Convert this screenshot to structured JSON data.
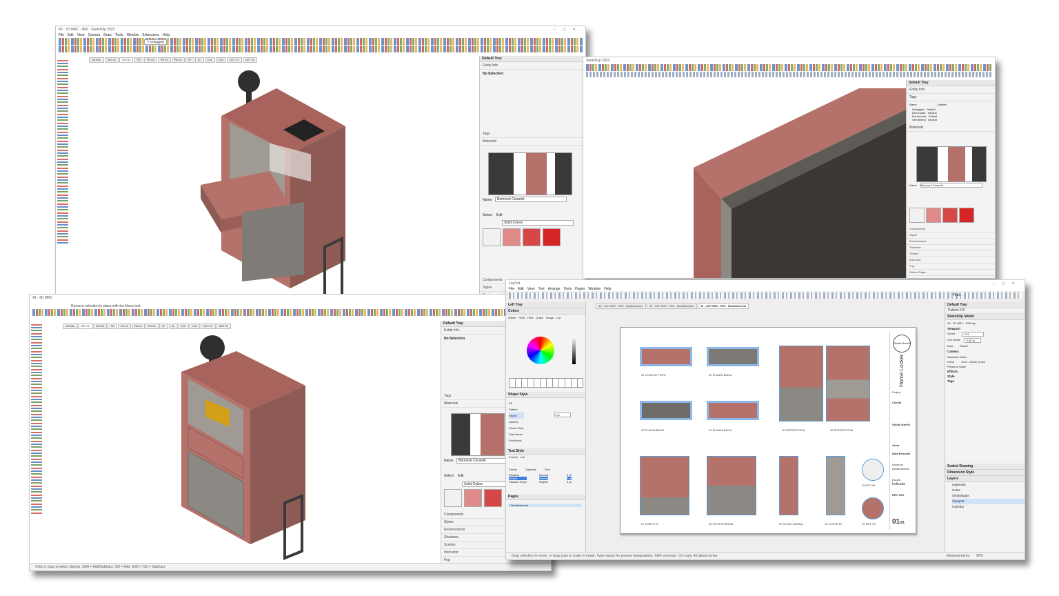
{
  "win1": {
    "title": "49 - 3D MRC - R00 - SketchUp 2023",
    "menus": [
      "File",
      "Edit",
      "View",
      "Camera",
      "Draw",
      "Tools",
      "Window",
      "Extensions",
      "Help"
    ],
    "tag_dropdown": "Untagged",
    "scene_tabs": [
      "GERAL",
      "ISO 01",
      "ISO 02",
      "PB",
      "PB 02",
      "PB 03",
      "PB 04",
      "VF",
      "VL",
      "C01",
      "C02",
      "DET 01",
      "DET 02"
    ],
    "tray_title": "Default Tray",
    "entity_info": "Entity Info",
    "no_selection": "No Selection",
    "tags": "Tags",
    "materials": "Materials",
    "material_name_label": "Name",
    "material_name": "Bermeck Ceramik",
    "select_tab": "Select",
    "edit_tab": "Edit",
    "solid_colors": "Solid Colors",
    "panels": [
      "Components",
      "Styles",
      "Environments",
      "Shadows",
      "Scenes",
      "Instructor",
      "Fog"
    ]
  },
  "win2": {
    "title": "SketchUp 2023",
    "tag_dropdown": "Untagged",
    "tray_title": "Default Tray",
    "entity_info": "Entity Info",
    "tags": "Tags",
    "tag_col_name": "Name",
    "tag_col_dashes": "Dashes",
    "tag_rows": [
      {
        "name": "Untagged",
        "dash": "Default",
        "color": "#333333"
      },
      {
        "name": "Decoração",
        "dash": "Default",
        "color": "#c0392b"
      },
      {
        "name": "Marcenaria",
        "dash": "Default",
        "color": "#2e5fa8"
      },
      {
        "name": "Serralheria",
        "dash": "Default",
        "color": "#d4a017"
      }
    ],
    "materials": "Materials",
    "material_name_label": "Name",
    "material_name": "Bermeck Ceramik",
    "select_tab": "Select",
    "edit_tab": "Edit",
    "solid_colors": "Solid Colors",
    "panels": [
      "Components",
      "Styles",
      "Environments",
      "Shadows",
      "Scenes",
      "Instructor",
      "Fog",
      "Soften Edges"
    ]
  },
  "win3": {
    "title": "49 - 3D MRC",
    "status_hint": "Remove selection to place with the Move tool.",
    "scene_tabs": [
      "GERAL",
      "ISO 01",
      "ISO 02",
      "PB",
      "PB 02",
      "PB 03",
      "PB 04",
      "VF",
      "VL",
      "C01",
      "C02",
      "DET 01",
      "DET 02"
    ],
    "tray_title": "Default Tray",
    "entity_info": "Entity Info",
    "no_selection": "No Selection",
    "tags": "Tags",
    "materials": "Materials",
    "material_name_label": "Name",
    "material_name": "Bermeck Ceramik",
    "select_tab": "Select",
    "edit_tab": "Edit",
    "solid_colors": "Solid Colors",
    "panels": [
      "Components",
      "Styles",
      "Environments",
      "Shadows",
      "Scenes",
      "Instructor",
      "Fog"
    ],
    "status": "Click or drag to select objects. Shift = Add/Subtract. Ctrl = Add. Shift + Ctrl = Subtract."
  },
  "layout": {
    "title": "LayOut",
    "menus": [
      "File",
      "Edit",
      "View",
      "Text",
      "Arrange",
      "Tools",
      "Pages",
      "Window",
      "Help"
    ],
    "doc_tabs": [
      "49 - LAY MRC - R00 - Detalhamento",
      "49 - LAY MRC - R00 - Detalhamento",
      "49 - LAY MRC - R00 - Detalhamento"
    ],
    "find": "Find...",
    "left_tray": "Left Tray",
    "colors": "Colors",
    "color_tabs": [
      "Wheel",
      "RGB",
      "HSB",
      "Grays",
      "Image",
      "List"
    ],
    "shape_style": "Shape Style",
    "shape_rows": [
      "Fill",
      "Pattern",
      "Stroke",
      "Dashes",
      "Stroke Style",
      "Start Arrow",
      "End Arrow"
    ],
    "stroke_size": "1 pt",
    "text_style": "Text Style",
    "text_tabs": [
      "Format",
      "List"
    ],
    "font_family_label": "Family",
    "font_typeface_label": "Typeface",
    "font_size_label": "Size",
    "fonts": [
      "Verdana",
      "Vivaldi",
      "Vladimir Script"
    ],
    "typefaces": [
      "Normal",
      "Normal",
      "Negrito"
    ],
    "sizes": [
      "5 pt",
      "5 pt",
      "5 pt"
    ],
    "pages": "Pages",
    "page_name": "1  Detalhamento",
    "right_tray": "Default Tray",
    "pattern_fill": "Pattern Fill",
    "sketchup_model": "SketchUp Model",
    "model_file": "49 - 3D MRC - R00.skp",
    "viewport": "Viewport",
    "scene_label": "Scene",
    "scene_value": "C01",
    "line_scale": "Line Scale",
    "line_scale_value": "0.50 pt",
    "render_auto": "Auto",
    "render_mode": "Raster",
    "camera": "Camera",
    "standard_views": "Standard Views",
    "ortho": "Ortho",
    "scale": "1mm : 25mm (1:25)",
    "preserve_scale": "Preserve Scale",
    "effects": "Effects",
    "style": "Style",
    "tags": "Tags",
    "reset": "Reset",
    "scaled_drawing": "Scaled Drawing",
    "dimension_style": "Dimension Style",
    "layers": "Layers",
    "layer_list": [
      "Legendas",
      "Cotas",
      "Simbologias",
      "Viewport",
      "Carimbo"
    ],
    "status": "Drag selection to move, or drag grips to scale or rotate. Type values for precise manipulation. Shift constrain. Ctrl copy. Alt about center.",
    "measurements": "Measurements",
    "zoom": "50%",
    "sheet": {
      "views": [
        {
          "num": "01",
          "name": "VISTA DE TOPO"
        },
        {
          "num": "02",
          "name": "PLANTA BAIXA"
        },
        {
          "num": "03",
          "name": "PLANTA BAIXA"
        },
        {
          "num": "04",
          "name": "PLANTA BAIXA"
        },
        {
          "num": "05",
          "name": "PERSPECTIVA"
        },
        {
          "num": "06",
          "name": "PERSPECTIVA"
        },
        {
          "num": "07",
          "name": "CORTE 07"
        },
        {
          "num": "08",
          "name": "VISTA FRONTAL"
        },
        {
          "num": "09",
          "name": "VISTA LATERAL"
        },
        {
          "num": "10",
          "name": "CORTE 10"
        },
        {
          "num": "11",
          "name": "DET. 01"
        },
        {
          "num": "12",
          "name": "DET. 02"
        }
      ],
      "title_block": {
        "studio": "Studio Barelli",
        "project_label": "Projeto",
        "project": "Home Locker",
        "client_label": "Cliente",
        "author_label": "Autor",
        "date_label": "Data Emissão",
        "drawing_label": "Desenho",
        "drawing": "Detalhamento",
        "scale_label": "Escala",
        "scale": "Indicada",
        "rev_label": "REV.",
        "rev": "R00",
        "sheet_no": "01",
        "sheet_total": "/01"
      }
    }
  },
  "colors": {
    "cabinet": "#b5726a",
    "cabinet_dark": "#8e5a54",
    "grey_panel": "#8c8883",
    "frame": "#3a3a3a",
    "lamp": "#2f2f2f",
    "select_blue": "#3d7fd9"
  }
}
